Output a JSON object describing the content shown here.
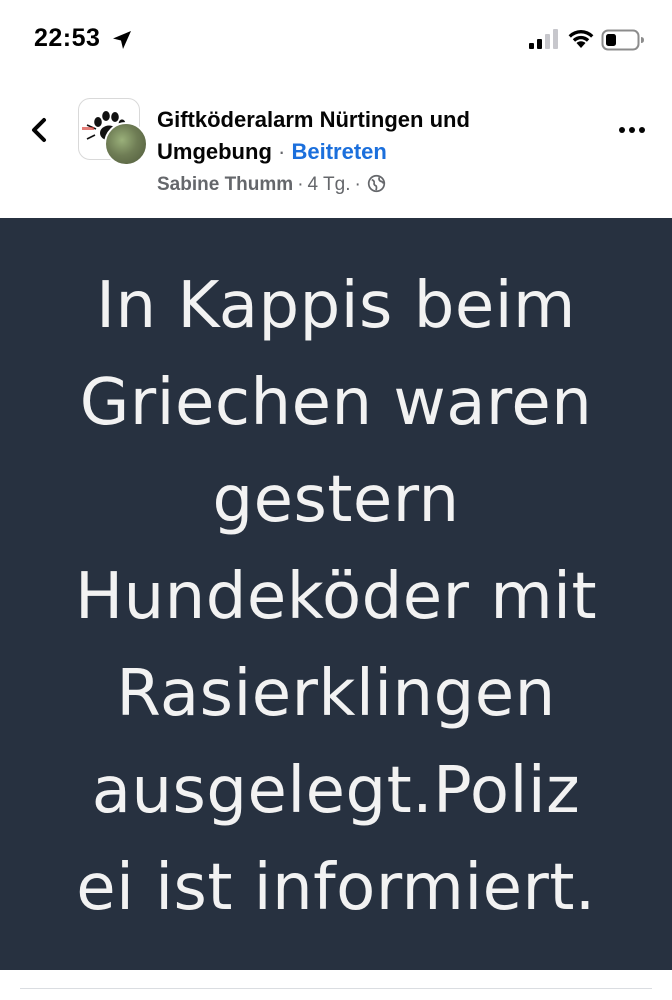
{
  "status_bar": {
    "time": "22:53",
    "icons": [
      "location-arrow-icon",
      "cellular-signal-icon",
      "wifi-icon",
      "battery-icon"
    ]
  },
  "post": {
    "group_name": "Giftköderalarm Nürtingen und Umgebung",
    "separator": "·",
    "join_label": "Beitreten",
    "author": "Sabine Thumm",
    "time_ago": "4 Tg.",
    "audience_icon": "globe-icon",
    "image_text_lines": [
      "In Kappis beim",
      "Griechen waren",
      "gestern",
      "Hundeköder mit",
      "Rasierklingen",
      "ausgelegt.Poliz",
      "ei ist informiert."
    ]
  },
  "colors": {
    "image_background": "#273140",
    "image_text": "#f2f2f2",
    "link": "#1b6fdc",
    "meta_text": "#65676b"
  }
}
